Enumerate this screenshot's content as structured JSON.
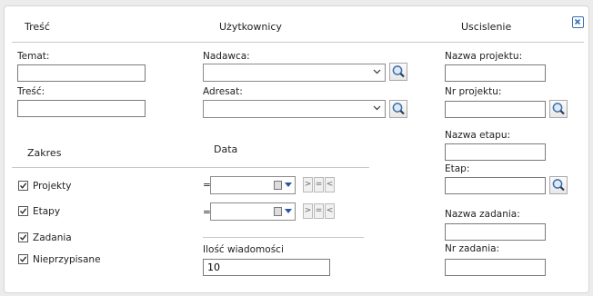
{
  "headers": {
    "tresc": "Treść",
    "uzytkownicy": "Użytkownicy",
    "uscislenie": "Uscislenie"
  },
  "close_icon": "close-icon",
  "fields": {
    "temat": {
      "label": "Temat:",
      "value": ""
    },
    "tresc": {
      "label": "Treść:",
      "value": ""
    },
    "nadawca": {
      "label": "Nadawca:",
      "value": ""
    },
    "adresat": {
      "label": "Adresat:",
      "value": ""
    },
    "nazwa_projektu": {
      "label": "Nazwa projektu:",
      "value": ""
    },
    "nr_projektu": {
      "label": "Nr projektu:",
      "value": ""
    },
    "nazwa_etapu": {
      "label": "Nazwa etapu:",
      "value": ""
    },
    "etap": {
      "label": "Etap:",
      "value": ""
    },
    "nazwa_zadania": {
      "label": "Nazwa zadania:",
      "value": ""
    },
    "nr_zadania": {
      "label": "Nr zadania:",
      "value": ""
    }
  },
  "zakres": {
    "title": "Zakres",
    "items": [
      {
        "label": "Projekty",
        "checked": true
      },
      {
        "label": "Etapy",
        "checked": true
      },
      {
        "label": "Zadania",
        "checked": true
      },
      {
        "label": "Nieprzypisane",
        "checked": true
      }
    ]
  },
  "data": {
    "title": "Data",
    "rows": [
      {
        "operator": "=",
        "value": "",
        "cmp": [
          ">",
          "=",
          "<"
        ]
      },
      {
        "operator": "=",
        "value": "",
        "cmp": [
          ">",
          "=",
          "<"
        ]
      }
    ]
  },
  "ilosc": {
    "label": "Ilość wiadomości",
    "value": "10"
  },
  "icons": {
    "search": "search-icon",
    "dropdown": "chevron-down-icon",
    "calendar": "calendar-icon"
  },
  "colors": {
    "accent": "#3a6fb5",
    "border": "#7a7a7a"
  }
}
